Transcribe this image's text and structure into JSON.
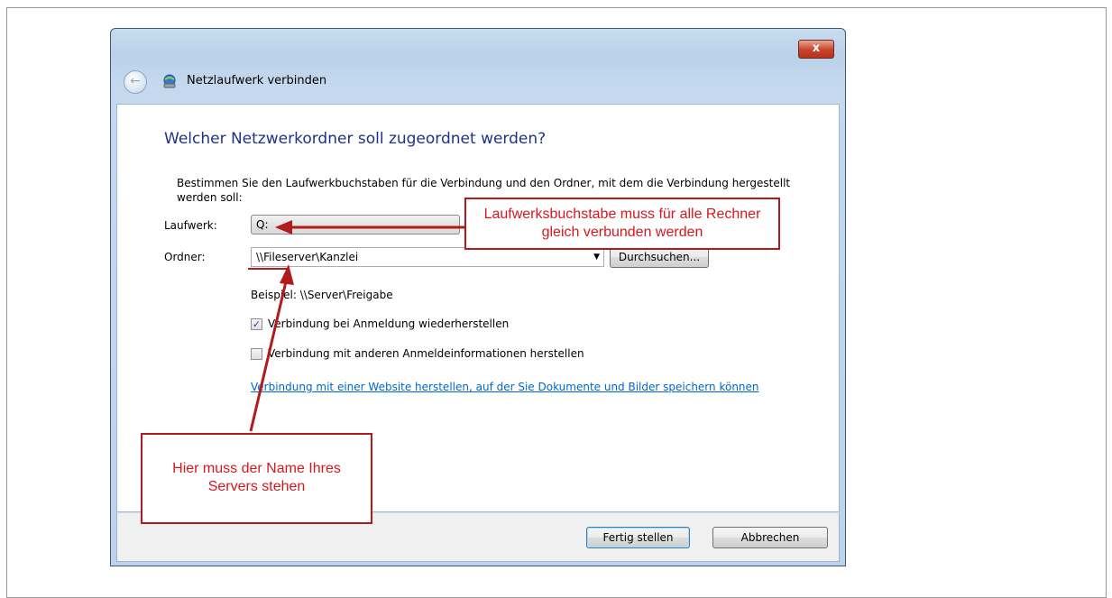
{
  "window": {
    "title": "Netzlaufwerk verbinden",
    "close_glyph": "x"
  },
  "content": {
    "heading": "Welcher Netzwerkordner soll zugeordnet werden?",
    "instruction": "Bestimmen Sie den Laufwerkbuchstaben für die Verbindung und den Ordner, mit dem die Verbindung hergestellt werden soll:",
    "drive_label": "Laufwerk:",
    "drive_value": "Q:",
    "folder_label": "Ordner:",
    "folder_value": "\\\\Fileserver\\Kanzlei",
    "browse_label": "Durchsuchen...",
    "example": "Beispiel: \\\\Server\\Freigabe",
    "checkbox_reconnect": {
      "label": "Verbindung bei Anmeldung wiederherstellen",
      "checked": true
    },
    "checkbox_credentials": {
      "label": "Verbindung mit anderen Anmeldeinformationen herstellen",
      "checked": false
    },
    "website_link": "Verbindung mit einer Website herstellen, auf der Sie Dokumente und Bilder speichern können"
  },
  "footer": {
    "finish_label": "Fertig stellen",
    "cancel_label": "Abbrechen"
  },
  "annotations": {
    "drive_callout": "Laufwerksbuchstabe muss für alle Rechner gleich verbunden werden",
    "server_callout": "Hier muss der Name Ihres Servers stehen",
    "callout_color": "#d6181e"
  }
}
